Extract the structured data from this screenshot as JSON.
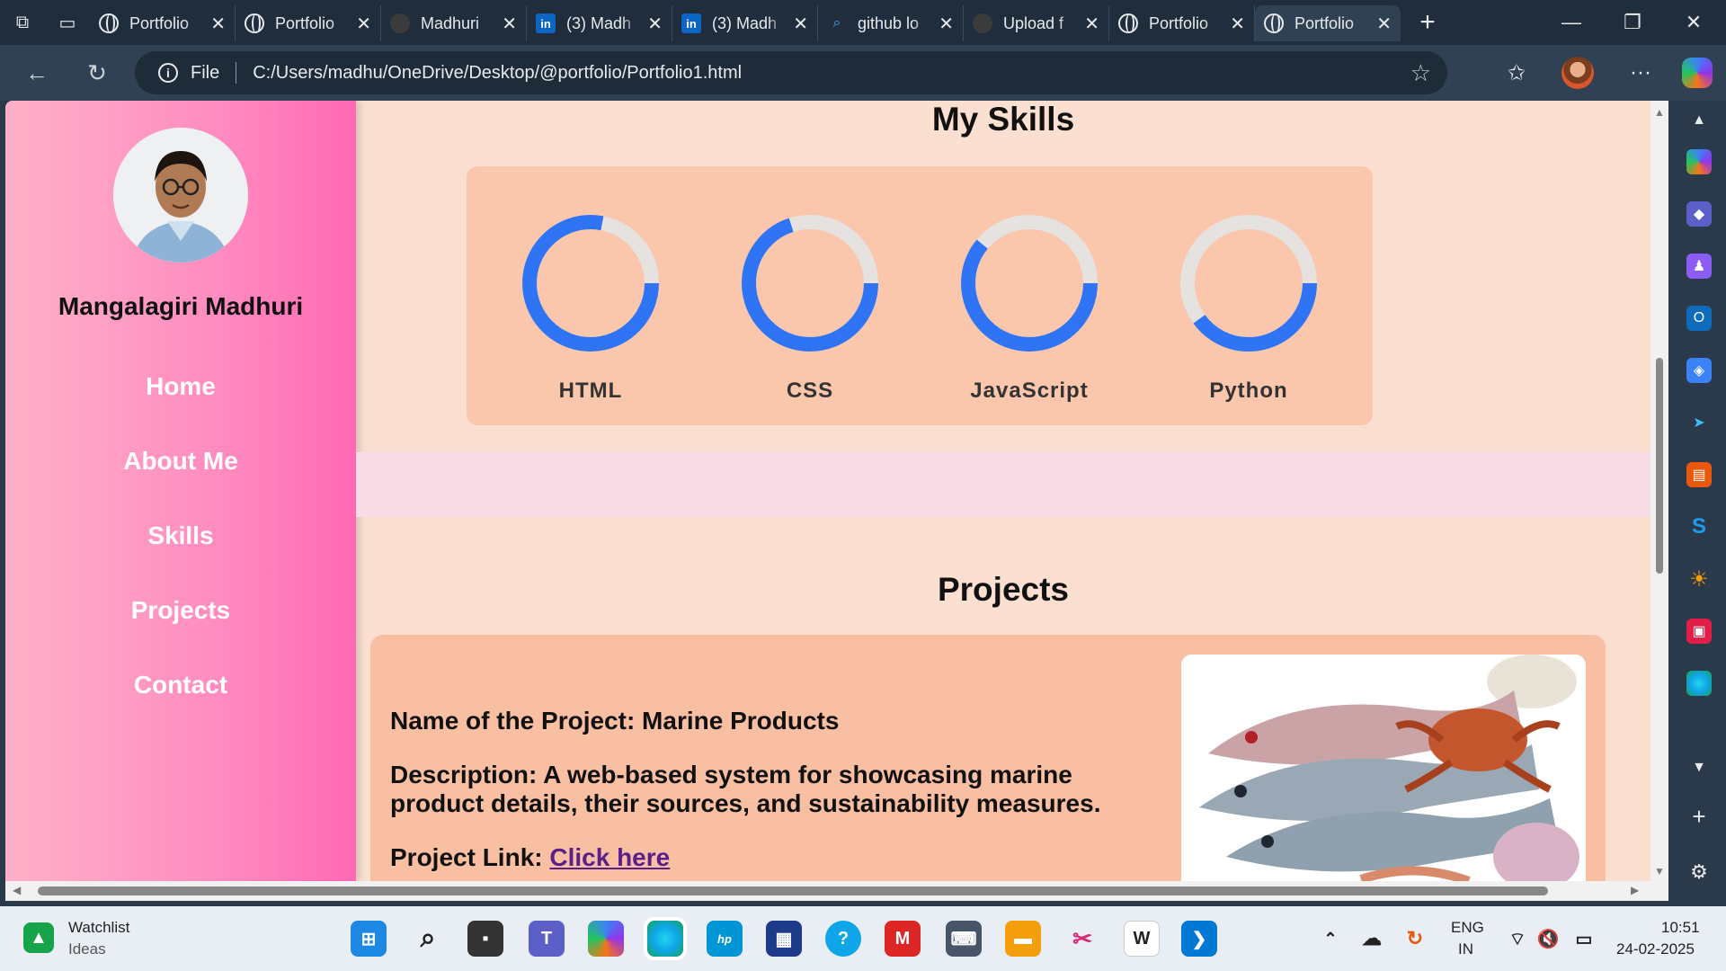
{
  "browser": {
    "tabs": [
      {
        "title": "Portfolio",
        "icon": "globe-icon",
        "active": false
      },
      {
        "title": "Portfolio",
        "icon": "globe-icon",
        "active": false
      },
      {
        "title": "Madhuri",
        "icon": "github-icon",
        "active": false
      },
      {
        "title": "(3) Madh",
        "icon": "linkedin-icon",
        "active": false
      },
      {
        "title": "(3) Madh",
        "icon": "linkedin-icon",
        "active": false
      },
      {
        "title": "github lo",
        "icon": "search-icon",
        "active": false
      },
      {
        "title": "Upload f",
        "icon": "github-icon",
        "active": false
      },
      {
        "title": "Portfolio",
        "icon": "globe-icon",
        "active": false
      },
      {
        "title": "Portfolio",
        "icon": "globe-icon",
        "active": true
      }
    ],
    "address": {
      "scheme_label": "File",
      "url": "C:/Users/madhu/OneDrive/Desktop/@portfolio/Portfolio1.html"
    }
  },
  "page": {
    "profile_name": "Mangalagiri Madhuri",
    "nav": [
      "Home",
      "About Me",
      "Skills",
      "Projects",
      "Contact"
    ],
    "skills_title": "My Skills",
    "skills": [
      {
        "name": "HTML",
        "progress": 0.78
      },
      {
        "name": "CSS",
        "progress": 0.7
      },
      {
        "name": "JavaScript",
        "progress": 0.61
      },
      {
        "name": "Python",
        "progress": 0.4
      }
    ],
    "colors": {
      "ring": "#2f74f5",
      "ring_track": "#e6e2e0",
      "sidebar_accent": "#ff69b4"
    },
    "projects_title": "Projects",
    "project": {
      "name_line": "Name of the Project: Marine Products",
      "description_line": "Description: A web-based system for showcasing marine product details, their sources, and sustainability measures.",
      "link_label": "Project Link:",
      "link_text": "Click here"
    }
  },
  "taskbar": {
    "widget_title": "Watchlist",
    "widget_subtitle": "Ideas",
    "lang_top": "ENG",
    "lang_bottom": "IN",
    "time": "10:51",
    "date": "24-02-2025"
  }
}
